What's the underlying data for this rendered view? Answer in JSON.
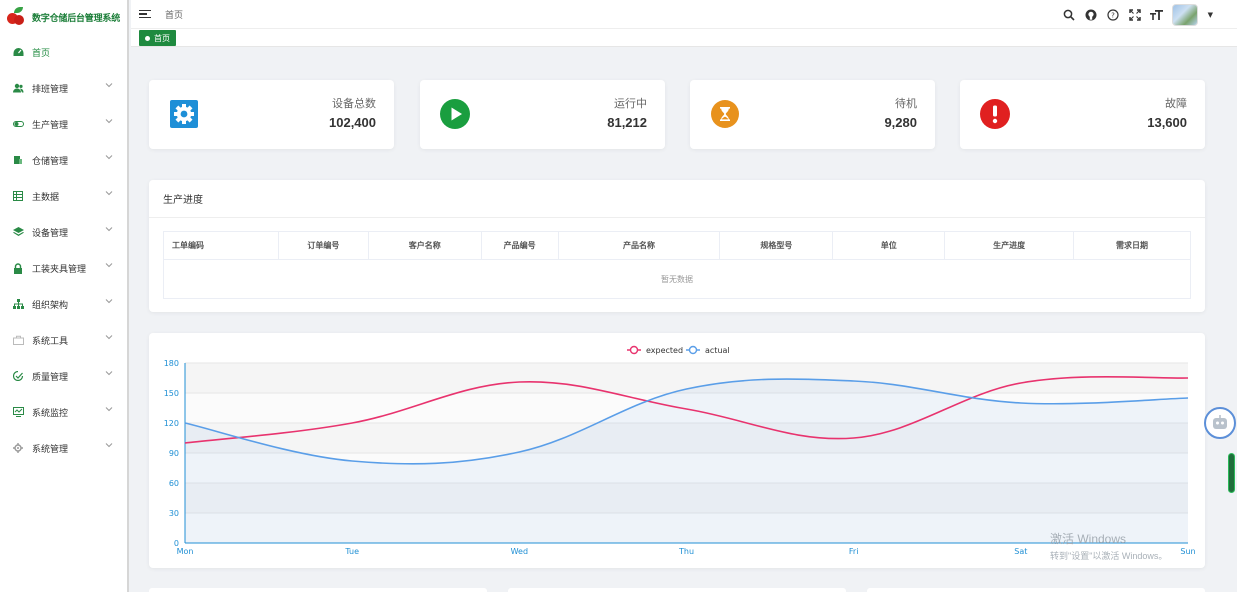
{
  "app": {
    "title": "数字仓储后台管理系统"
  },
  "sidebar": {
    "items": [
      {
        "label": "首页",
        "icon": "dashboard-icon",
        "active": true,
        "has_children": false
      },
      {
        "label": "排班管理",
        "icon": "users-icon",
        "has_children": true
      },
      {
        "label": "生产管理",
        "icon": "toggle-icon",
        "has_children": true
      },
      {
        "label": "仓储管理",
        "icon": "warehouse-icon",
        "has_children": true
      },
      {
        "label": "主数据",
        "icon": "table-icon",
        "has_children": true
      },
      {
        "label": "设备管理",
        "icon": "layers-icon",
        "has_children": true
      },
      {
        "label": "工装夹具管理",
        "icon": "lock-icon",
        "has_children": true
      },
      {
        "label": "组织架构",
        "icon": "org-tree-icon",
        "has_children": true
      },
      {
        "label": "系统工具",
        "icon": "toolbox-icon",
        "has_children": true
      },
      {
        "label": "质量管理",
        "icon": "quality-icon",
        "has_children": true
      },
      {
        "label": "系统监控",
        "icon": "monitor-icon",
        "has_children": true
      },
      {
        "label": "系统管理",
        "icon": "gear-icon",
        "has_children": true
      }
    ]
  },
  "header": {
    "breadcrumb": "首页",
    "tools": [
      "search-icon",
      "github-icon",
      "help-icon",
      "fullscreen-icon",
      "font-size-icon"
    ],
    "active_tag": "首页"
  },
  "stats": [
    {
      "label": "设备总数",
      "value": "102,400",
      "icon": "gear-icon",
      "color": "#1e8fd7"
    },
    {
      "label": "运行中",
      "value": "81,212",
      "icon": "play-icon",
      "color": "#1a9e3f"
    },
    {
      "label": "待机",
      "value": "9,280",
      "icon": "hourglass-icon",
      "color": "#e8921d"
    },
    {
      "label": "故障",
      "value": "13,600",
      "icon": "exclamation-icon",
      "color": "#e02020"
    }
  ],
  "progress": {
    "title": "生产进度",
    "columns": [
      "工单编码",
      "订单编号",
      "客户名称",
      "产品编号",
      "产品名称",
      "规格型号",
      "单位",
      "生产进度",
      "需求日期"
    ],
    "empty_text": "暂无数据"
  },
  "chart_data": {
    "type": "line",
    "categories": [
      "Mon",
      "Tue",
      "Wed",
      "Thu",
      "Fri",
      "Sat",
      "Sun"
    ],
    "series": [
      {
        "name": "expected",
        "values": [
          100,
          120,
          161,
          134,
          105,
          160,
          165
        ],
        "color": "#e8336e"
      },
      {
        "name": "actual",
        "values": [
          120,
          82,
          91,
          154,
          162,
          140,
          145
        ],
        "color": "#5a9ee8"
      }
    ],
    "ylim": [
      0,
      180
    ],
    "yticks": [
      0,
      30,
      60,
      90,
      120,
      150,
      180
    ],
    "legend_position": "top-center",
    "smooth": true
  },
  "watermark": {
    "line1": "激活 Windows",
    "line2": "转到\"设置\"以激活 Windows。"
  }
}
